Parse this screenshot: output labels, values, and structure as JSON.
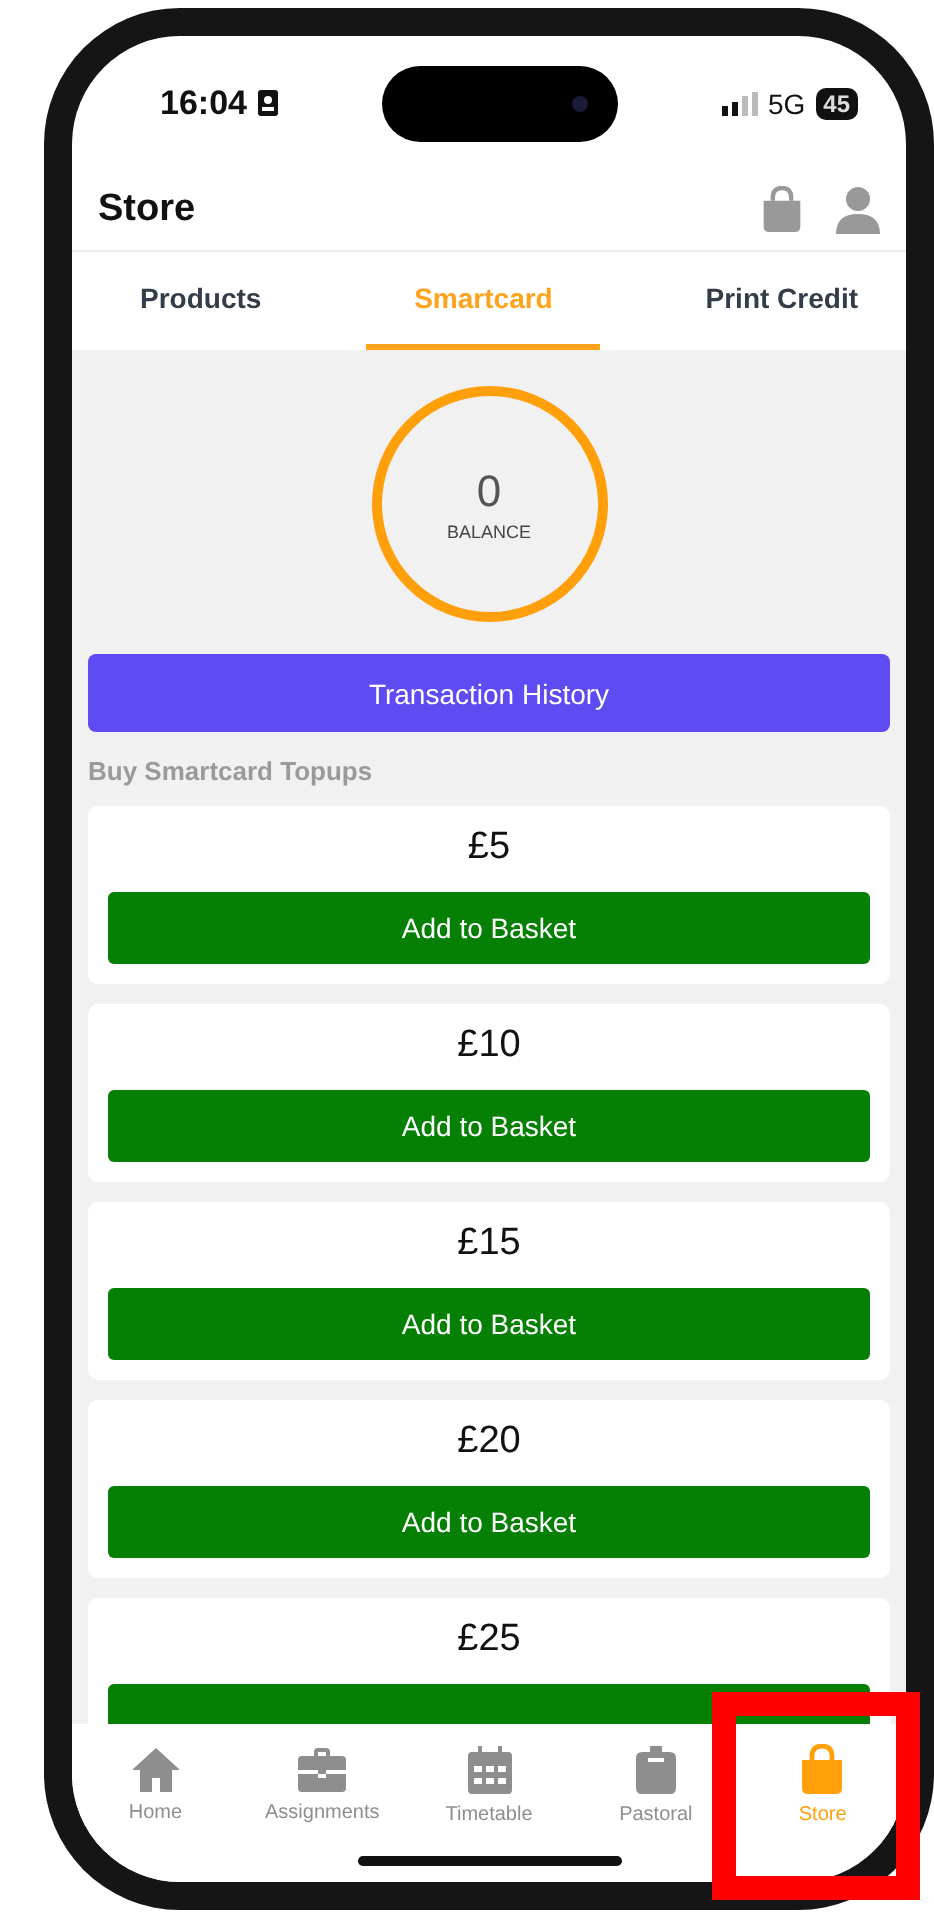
{
  "status_bar": {
    "time": "16:04",
    "network": "5G",
    "battery": "45"
  },
  "header": {
    "title": "Store"
  },
  "tabs": [
    {
      "label": "Products",
      "selected": false
    },
    {
      "label": "Smartcard",
      "selected": true
    },
    {
      "label": "Print Credit",
      "selected": false
    }
  ],
  "balance": {
    "amount": "0",
    "label": "BALANCE"
  },
  "history_button": "Transaction History",
  "section_title": "Buy Smartcard Topups",
  "topups": [
    {
      "price": "£5",
      "button": "Add to Basket"
    },
    {
      "price": "£10",
      "button": "Add to Basket"
    },
    {
      "price": "£15",
      "button": "Add to Basket"
    },
    {
      "price": "£20",
      "button": "Add to Basket"
    },
    {
      "price": "£25"
    }
  ],
  "nav": [
    {
      "label": "Home",
      "kind": "home",
      "selected": false,
      "highlighted": false
    },
    {
      "label": "Assignments",
      "kind": "briefcase",
      "selected": false,
      "highlighted": false
    },
    {
      "label": "Timetable",
      "kind": "calendar",
      "selected": false,
      "highlighted": false
    },
    {
      "label": "Pastoral",
      "kind": "clipboard",
      "selected": false,
      "highlighted": false
    },
    {
      "label": "Store",
      "kind": "bag",
      "selected": true,
      "highlighted": true
    }
  ]
}
